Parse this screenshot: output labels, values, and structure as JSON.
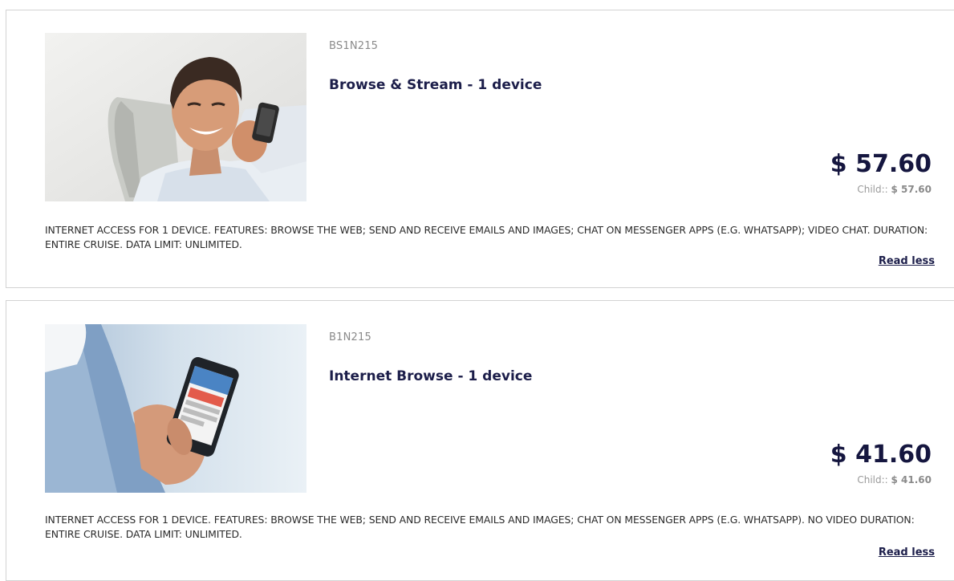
{
  "products": [
    {
      "code": "BS1N215",
      "title": "Browse & Stream - 1 device",
      "price": "$ 57.60",
      "child_label": "Child::",
      "child_price": "$  57.60",
      "description": "INTERNET ACCESS FOR 1 DEVICE. FEATURES: BROWSE THE WEB; SEND AND RECEIVE EMAILS AND IMAGES; CHAT ON MESSENGER APPS (E.G. WHATSAPP); VIDEO CHAT. DURATION: ENTIRE CRUISE. DATA LIMIT: UNLIMITED.",
      "toggle_label": "Read less",
      "image_icon": "man-with-phone-photo"
    },
    {
      "code": "B1N215",
      "title": "Internet Browse - 1 device",
      "price": "$ 41.60",
      "child_label": "Child::",
      "child_price": "$  41.60",
      "description": "INTERNET ACCESS FOR 1 DEVICE. FEATURES: BROWSE THE WEB; SEND AND RECEIVE EMAILS AND IMAGES; CHAT ON MESSENGER APPS (E.G. WHATSAPP). NO VIDEO DURATION: ENTIRE CRUISE. DATA LIMIT: UNLIMITED.",
      "toggle_label": "Read less",
      "image_icon": "hand-holding-phone-photo"
    }
  ],
  "colors": {
    "title": "#1c1e4a",
    "price": "#15163f",
    "muted": "#8a8a8a",
    "border": "#d3d3d3"
  }
}
